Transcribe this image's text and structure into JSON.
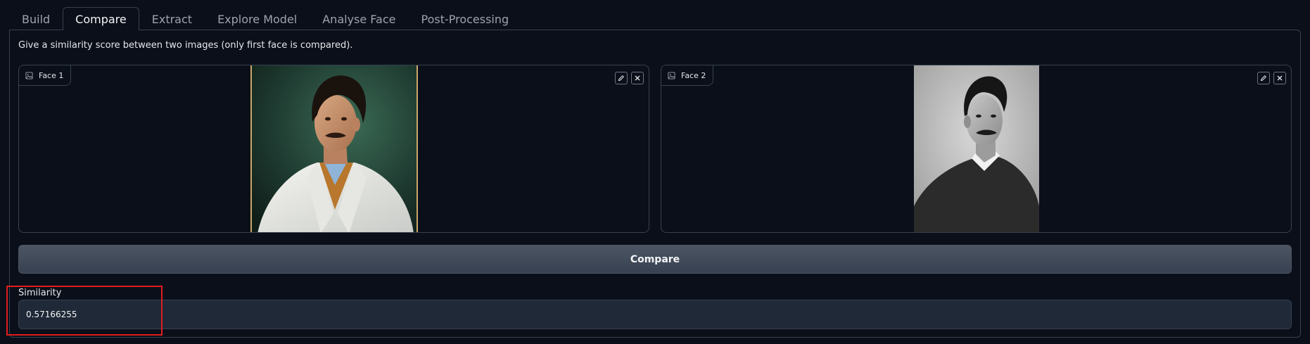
{
  "tabs": [
    {
      "label": "Build"
    },
    {
      "label": "Compare"
    },
    {
      "label": "Extract"
    },
    {
      "label": "Explore Model"
    },
    {
      "label": "Analyse Face"
    },
    {
      "label": "Post-Processing"
    }
  ],
  "active_tab": "Compare",
  "description": "Give a similarity score between two images (only first face is compared).",
  "face1": {
    "label": "Face 1",
    "icon": "image-icon"
  },
  "face2": {
    "label": "Face 2",
    "icon": "image-icon"
  },
  "compare_button": "Compare",
  "similarity": {
    "label": "Similarity",
    "value": "0.57166255"
  },
  "colors": {
    "background": "#0b0f19",
    "border": "#374151",
    "button": "#4b5563",
    "output_bg": "#1f2937",
    "highlight": "#e11d1d"
  }
}
